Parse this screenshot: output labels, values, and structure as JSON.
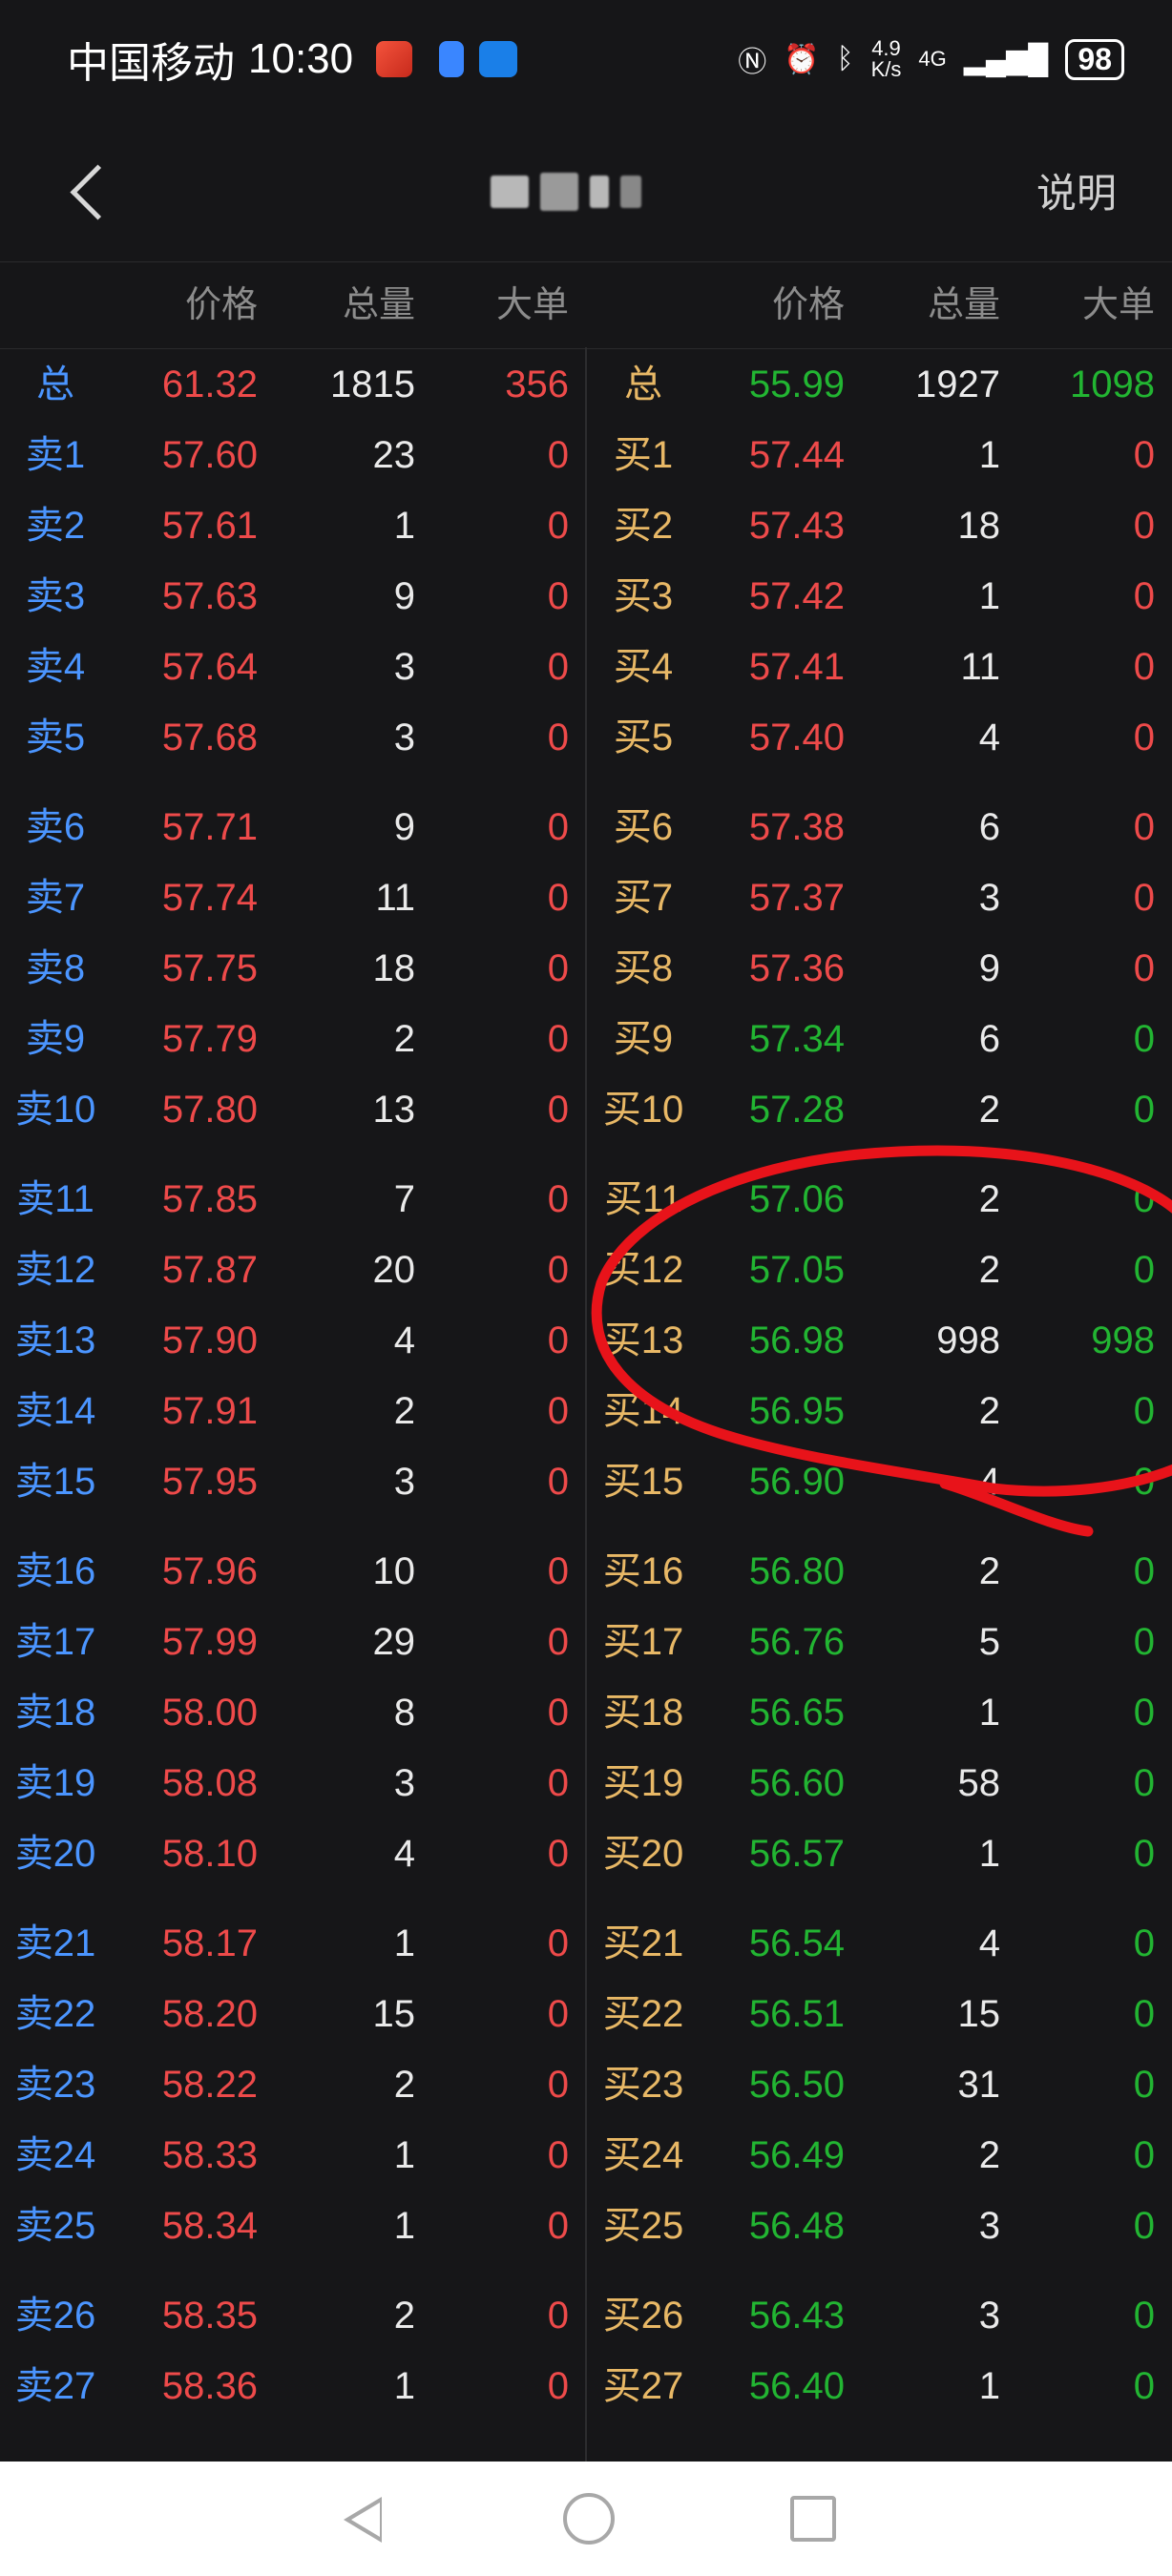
{
  "status_bar": {
    "carrier": "中国移动",
    "time": "10:30",
    "speed_value": "4.9",
    "speed_unit": "K/s",
    "network": "4G",
    "battery": "98"
  },
  "nav": {
    "help_label": "说明"
  },
  "header": {
    "ask": {
      "price": "价格",
      "volume": "总量",
      "large": "大单"
    },
    "bid": {
      "price": "价格",
      "volume": "总量",
      "large": "大单"
    }
  },
  "colors": {
    "ask_label": "#4b95ff",
    "bid_label": "#e8b866",
    "up": "#ee4a4a",
    "down": "#22b532",
    "annotation": "#e8131a"
  },
  "totals": {
    "ask": {
      "label": "总",
      "price": "61.32",
      "volume": "1815",
      "large": "356"
    },
    "bid": {
      "label": "总",
      "price": "55.99",
      "volume": "1927",
      "large": "1098"
    }
  },
  "asks": [
    {
      "label": "卖1",
      "price": "57.60",
      "volume": "23",
      "large": "0"
    },
    {
      "label": "卖2",
      "price": "57.61",
      "volume": "1",
      "large": "0"
    },
    {
      "label": "卖3",
      "price": "57.63",
      "volume": "9",
      "large": "0"
    },
    {
      "label": "卖4",
      "price": "57.64",
      "volume": "3",
      "large": "0"
    },
    {
      "label": "卖5",
      "price": "57.68",
      "volume": "3",
      "large": "0"
    },
    {
      "label": "卖6",
      "price": "57.71",
      "volume": "9",
      "large": "0"
    },
    {
      "label": "卖7",
      "price": "57.74",
      "volume": "11",
      "large": "0"
    },
    {
      "label": "卖8",
      "price": "57.75",
      "volume": "18",
      "large": "0"
    },
    {
      "label": "卖9",
      "price": "57.79",
      "volume": "2",
      "large": "0"
    },
    {
      "label": "卖10",
      "price": "57.80",
      "volume": "13",
      "large": "0"
    },
    {
      "label": "卖11",
      "price": "57.85",
      "volume": "7",
      "large": "0"
    },
    {
      "label": "卖12",
      "price": "57.87",
      "volume": "20",
      "large": "0"
    },
    {
      "label": "卖13",
      "price": "57.90",
      "volume": "4",
      "large": "0"
    },
    {
      "label": "卖14",
      "price": "57.91",
      "volume": "2",
      "large": "0"
    },
    {
      "label": "卖15",
      "price": "57.95",
      "volume": "3",
      "large": "0"
    },
    {
      "label": "卖16",
      "price": "57.96",
      "volume": "10",
      "large": "0"
    },
    {
      "label": "卖17",
      "price": "57.99",
      "volume": "29",
      "large": "0"
    },
    {
      "label": "卖18",
      "price": "58.00",
      "volume": "8",
      "large": "0"
    },
    {
      "label": "卖19",
      "price": "58.08",
      "volume": "3",
      "large": "0"
    },
    {
      "label": "卖20",
      "price": "58.10",
      "volume": "4",
      "large": "0"
    },
    {
      "label": "卖21",
      "price": "58.17",
      "volume": "1",
      "large": "0"
    },
    {
      "label": "卖22",
      "price": "58.20",
      "volume": "15",
      "large": "0"
    },
    {
      "label": "卖23",
      "price": "58.22",
      "volume": "2",
      "large": "0"
    },
    {
      "label": "卖24",
      "price": "58.33",
      "volume": "1",
      "large": "0"
    },
    {
      "label": "卖25",
      "price": "58.34",
      "volume": "1",
      "large": "0"
    },
    {
      "label": "卖26",
      "price": "58.35",
      "volume": "2",
      "large": "0"
    },
    {
      "label": "卖27",
      "price": "58.36",
      "volume": "1",
      "large": "0"
    }
  ],
  "bids": [
    {
      "label": "买1",
      "price": "57.44",
      "volume": "1",
      "large": "0",
      "trend": "up"
    },
    {
      "label": "买2",
      "price": "57.43",
      "volume": "18",
      "large": "0",
      "trend": "up"
    },
    {
      "label": "买3",
      "price": "57.42",
      "volume": "1",
      "large": "0",
      "trend": "up"
    },
    {
      "label": "买4",
      "price": "57.41",
      "volume": "11",
      "large": "0",
      "trend": "up"
    },
    {
      "label": "买5",
      "price": "57.40",
      "volume": "4",
      "large": "0",
      "trend": "up"
    },
    {
      "label": "买6",
      "price": "57.38",
      "volume": "6",
      "large": "0",
      "trend": "up"
    },
    {
      "label": "买7",
      "price": "57.37",
      "volume": "3",
      "large": "0",
      "trend": "up"
    },
    {
      "label": "买8",
      "price": "57.36",
      "volume": "9",
      "large": "0",
      "trend": "up"
    },
    {
      "label": "买9",
      "price": "57.34",
      "volume": "6",
      "large": "0",
      "trend": "down"
    },
    {
      "label": "买10",
      "price": "57.28",
      "volume": "2",
      "large": "0",
      "trend": "down"
    },
    {
      "label": "买11",
      "price": "57.06",
      "volume": "2",
      "large": "0",
      "trend": "down"
    },
    {
      "label": "买12",
      "price": "57.05",
      "volume": "2",
      "large": "0",
      "trend": "down"
    },
    {
      "label": "买13",
      "price": "56.98",
      "volume": "998",
      "large": "998",
      "trend": "down"
    },
    {
      "label": "买14",
      "price": "56.95",
      "volume": "2",
      "large": "0",
      "trend": "down"
    },
    {
      "label": "买15",
      "price": "56.90",
      "volume": "4",
      "large": "0",
      "trend": "down"
    },
    {
      "label": "买16",
      "price": "56.80",
      "volume": "2",
      "large": "0",
      "trend": "down"
    },
    {
      "label": "买17",
      "price": "56.76",
      "volume": "5",
      "large": "0",
      "trend": "down"
    },
    {
      "label": "买18",
      "price": "56.65",
      "volume": "1",
      "large": "0",
      "trend": "down"
    },
    {
      "label": "买19",
      "price": "56.60",
      "volume": "58",
      "large": "0",
      "trend": "down"
    },
    {
      "label": "买20",
      "price": "56.57",
      "volume": "1",
      "large": "0",
      "trend": "down"
    },
    {
      "label": "买21",
      "price": "56.54",
      "volume": "4",
      "large": "0",
      "trend": "down"
    },
    {
      "label": "买22",
      "price": "56.51",
      "volume": "15",
      "large": "0",
      "trend": "down"
    },
    {
      "label": "买23",
      "price": "56.50",
      "volume": "31",
      "large": "0",
      "trend": "down"
    },
    {
      "label": "买24",
      "price": "56.49",
      "volume": "2",
      "large": "0",
      "trend": "down"
    },
    {
      "label": "买25",
      "price": "56.48",
      "volume": "3",
      "large": "0",
      "trend": "down"
    },
    {
      "label": "买26",
      "price": "56.43",
      "volume": "3",
      "large": "0",
      "trend": "down"
    },
    {
      "label": "买27",
      "price": "56.40",
      "volume": "1",
      "large": "0",
      "trend": "down"
    }
  ]
}
